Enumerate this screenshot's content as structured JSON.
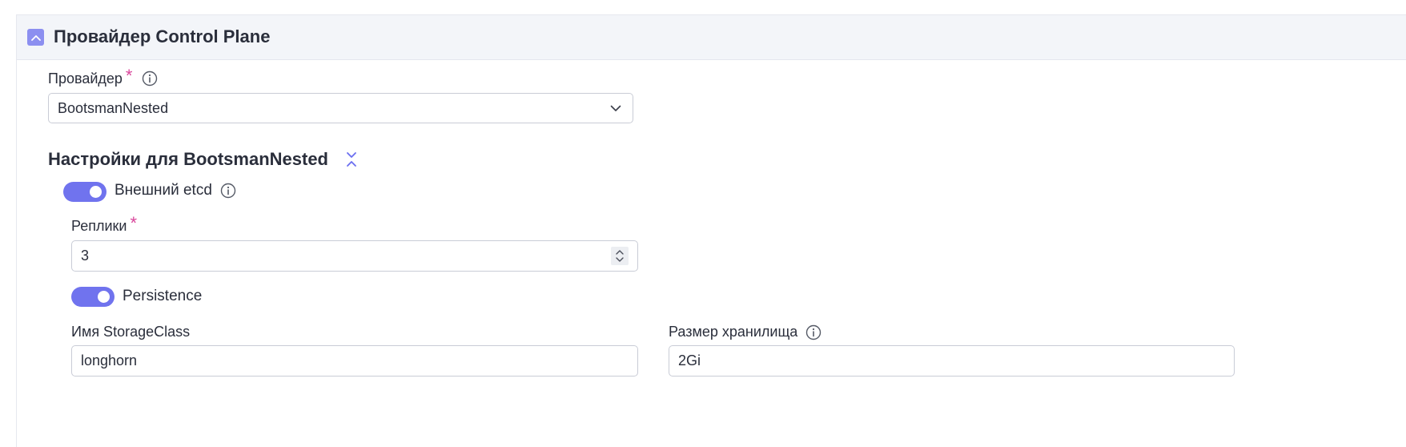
{
  "panel": {
    "title": "Провайдер Control Plane",
    "collapse_icon": "chevron-up-icon"
  },
  "provider": {
    "label": "Провайдер",
    "required_mark": "*",
    "value": "BootsmanNested",
    "info_icon": "info-icon",
    "dropdown_icon": "chevron-down-icon"
  },
  "settings": {
    "title": "Настройки для BootsmanNested",
    "expand_icon": "collapse-vertical-icon"
  },
  "external_etcd": {
    "label": "Внешний etcd",
    "enabled": true
  },
  "replicas": {
    "label": "Реплики",
    "required_mark": "*",
    "value": "3"
  },
  "persistence": {
    "label": "Persistence",
    "enabled": true
  },
  "storage_class": {
    "label": "Имя StorageClass",
    "value": "longhorn"
  },
  "storage_size": {
    "label": "Размер хранилища",
    "value": "2Gi"
  },
  "colors": {
    "accent": "#7073ee",
    "required": "#d9479b",
    "header_bg": "#f3f5f9"
  }
}
